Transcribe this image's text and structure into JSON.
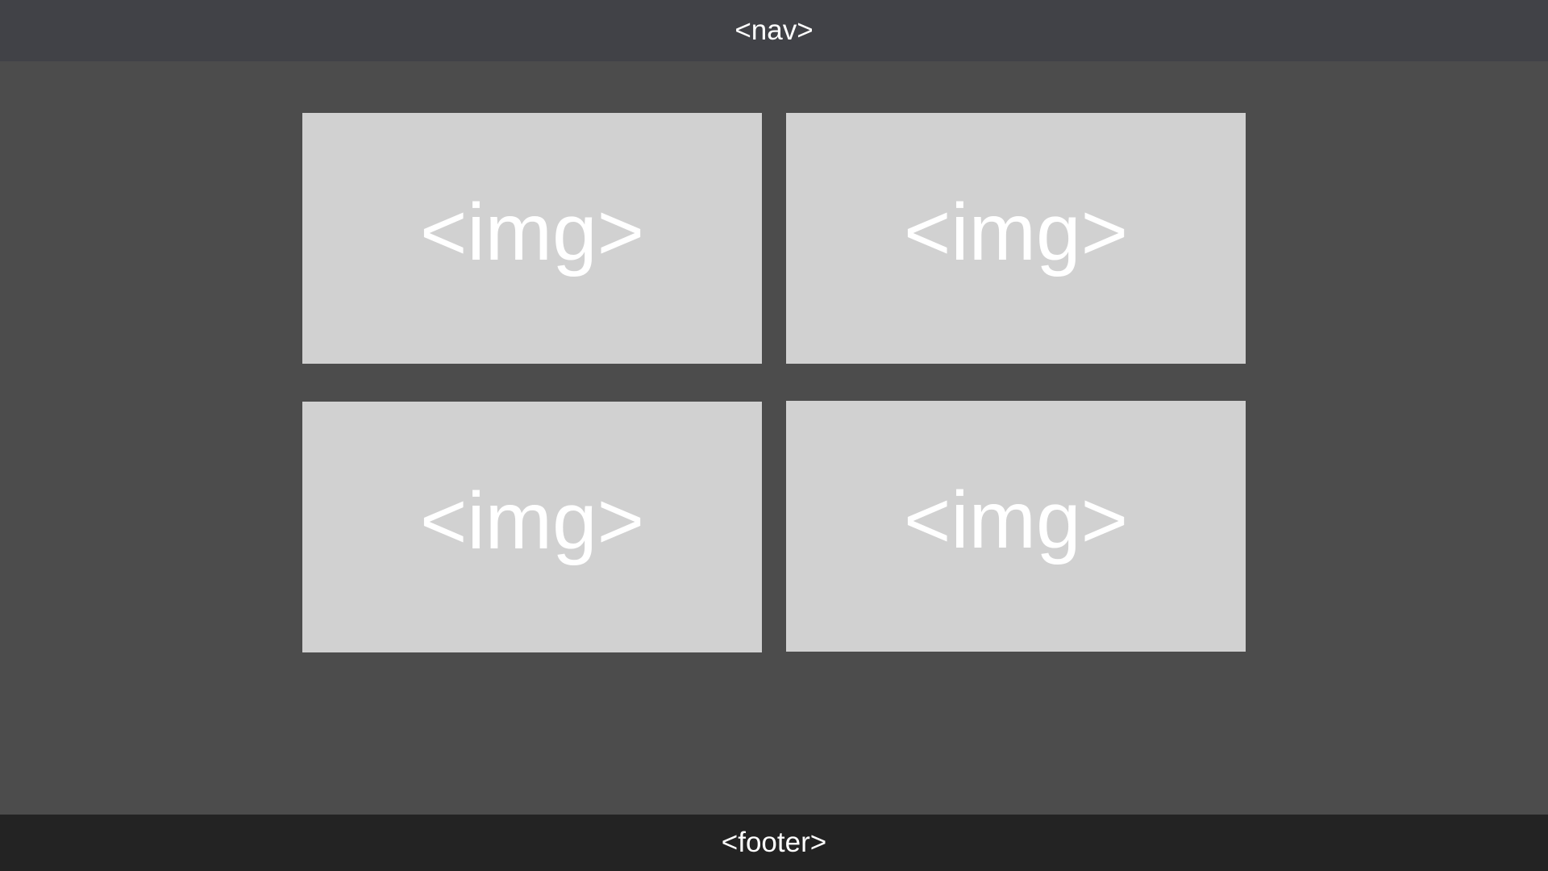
{
  "nav": {
    "label": "<nav>"
  },
  "images": [
    {
      "label": "<img>"
    },
    {
      "label": "<img>"
    },
    {
      "label": "<img>"
    },
    {
      "label": "<img>"
    }
  ],
  "footer": {
    "label": "<footer>"
  },
  "colors": {
    "background": "#4c4c4c",
    "nav": "#414247",
    "footer": "#232323",
    "image_placeholder": "#d1d1d1",
    "text": "#ffffff"
  }
}
